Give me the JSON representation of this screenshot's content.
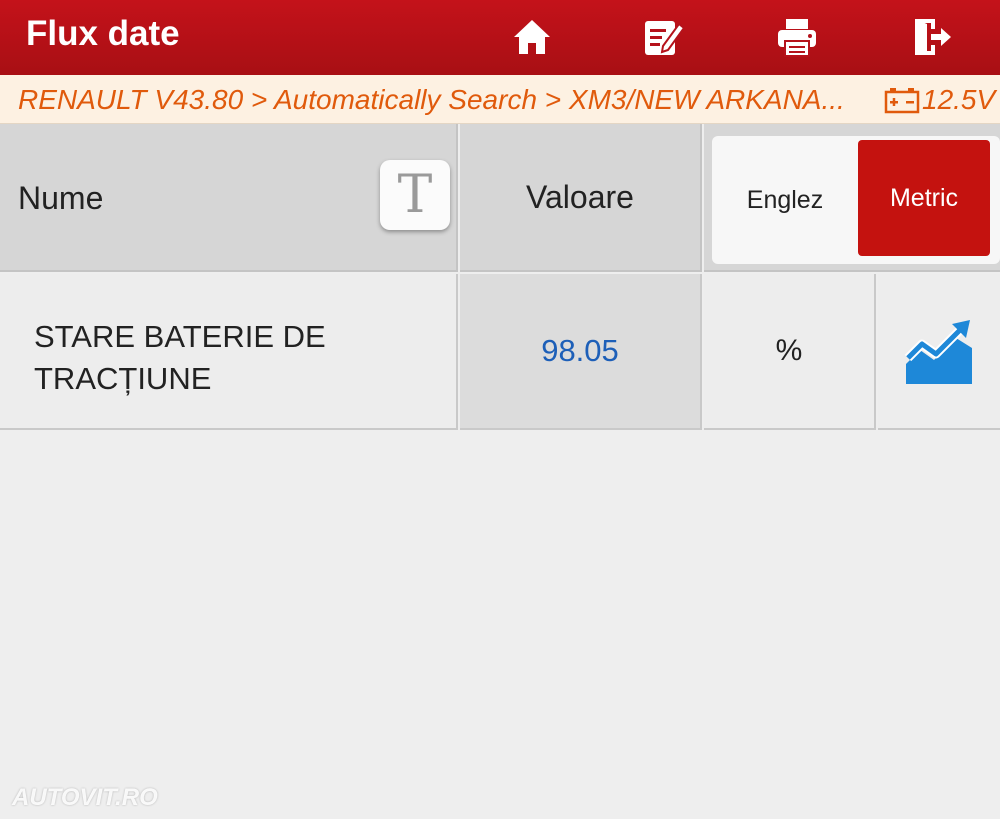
{
  "header": {
    "title": "Flux date",
    "icons": [
      "home-icon",
      "edit-icon",
      "print-icon",
      "exit-icon"
    ],
    "bg_color": "#b5121b"
  },
  "breadcrumb": {
    "path": "RENAULT V43.80 > Automatically Search > XM3/NEW ARKANA...",
    "battery_voltage": "12.5V",
    "text_color": "#e05a0c"
  },
  "table": {
    "headers": {
      "name": "Nume",
      "value": "Valoare",
      "font_button": "T"
    },
    "units_toggle": {
      "english": "Englez",
      "metric": "Metric",
      "selected": "Metric"
    },
    "rows": [
      {
        "name": "STARE BATERIE DE TRACȚIUNE",
        "value": "98.05",
        "unit": "%",
        "graph_icon": "trend-chart-icon"
      }
    ]
  },
  "watermark": "AUTOVIT.RO"
}
